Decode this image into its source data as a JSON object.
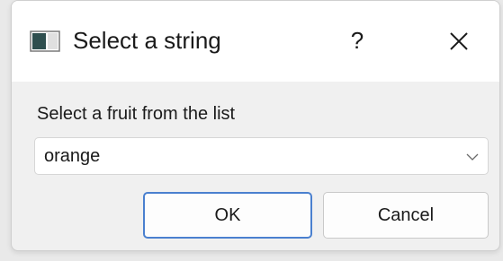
{
  "window": {
    "title": "Select a string",
    "help_label": "?",
    "app_icon": "window-app-icon",
    "close_icon": "close-icon"
  },
  "prompt": "Select a fruit from the list",
  "combo": {
    "value": "orange",
    "chevron_icon": "chevron-down-icon"
  },
  "buttons": {
    "ok": "OK",
    "cancel": "Cancel"
  },
  "colors": {
    "accent": "#4a80cf",
    "titlebar": "#ffffff",
    "body": "#f0f0f0"
  }
}
